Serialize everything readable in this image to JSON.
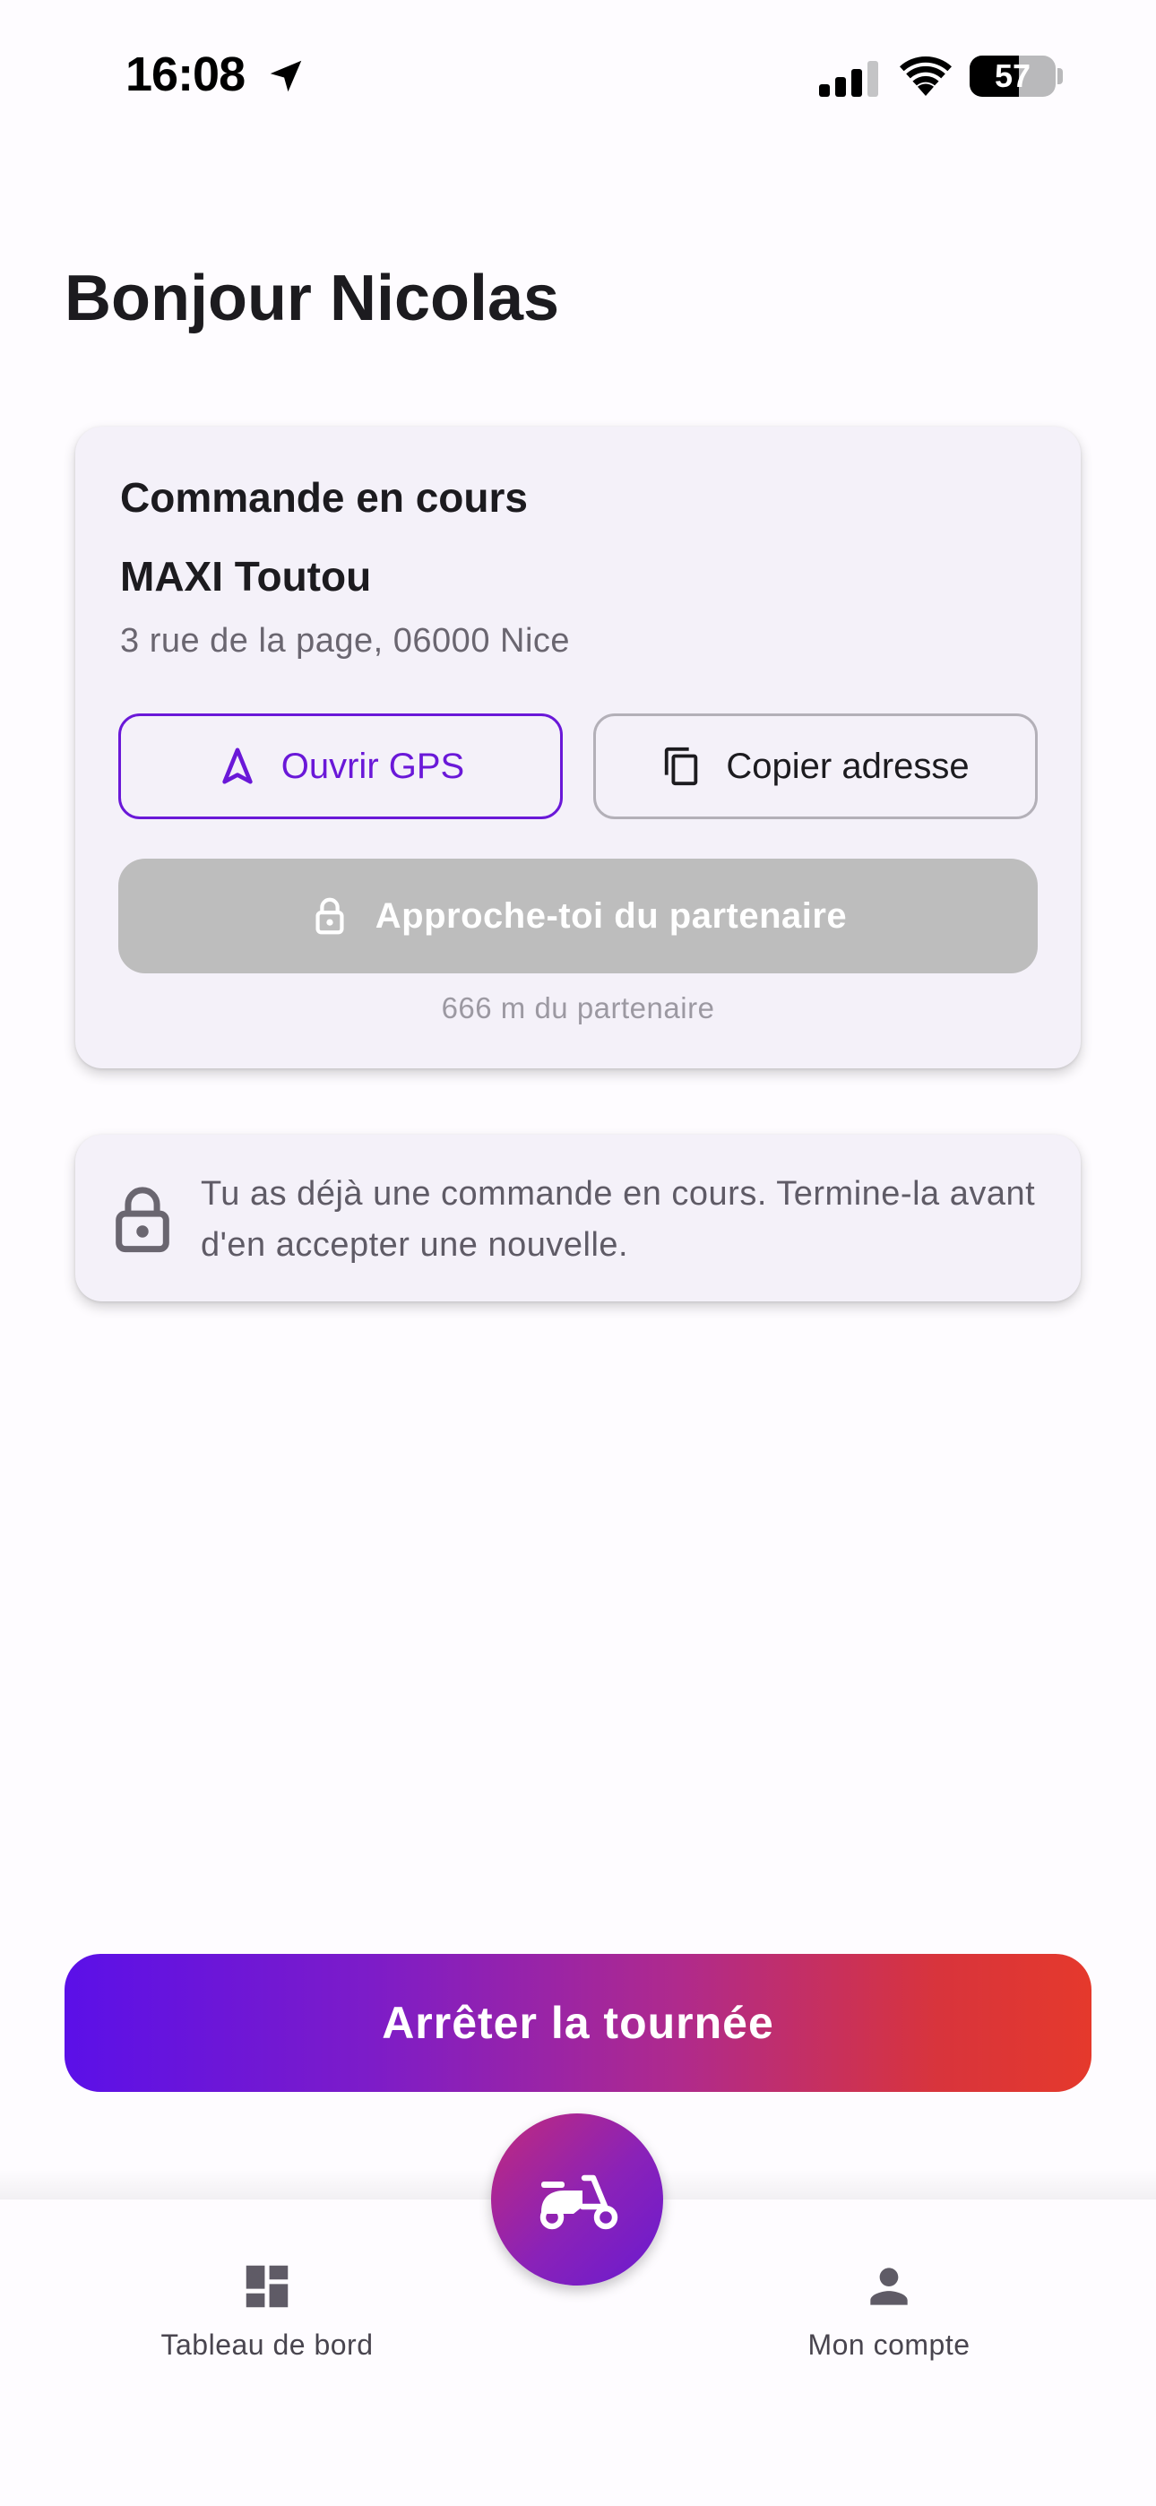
{
  "status_bar": {
    "time": "16:08",
    "battery": "57",
    "battery_level": 0.57,
    "icons": [
      "location-arrow-icon",
      "cellular-signal-icon",
      "wifi-icon",
      "battery-icon"
    ]
  },
  "greeting": "Bonjour Nicolas",
  "order_card": {
    "title": "Commande en cours",
    "partner_name": "MAXI Toutou",
    "address": "3 rue de la page, 06000 Nice",
    "gps_button": {
      "label": "Ouvrir GPS",
      "icon": "navigation-arrow-icon"
    },
    "copy_button": {
      "label": "Copier adresse",
      "icon": "copy-icon"
    },
    "approach_button": {
      "label": "Approche-toi du partenaire",
      "icon": "lock-icon",
      "enabled": false
    },
    "distance": "666 m du partenaire"
  },
  "info_card": {
    "icon": "lock-icon",
    "message": "Tu as déjà une commande en cours. Termine-la avant d'en accepter une nouvelle."
  },
  "stop_button": {
    "label": "Arrêter la tournée"
  },
  "bottom_nav": {
    "items": [
      {
        "label": "Tableau de bord",
        "icon": "dashboard-icon"
      },
      {
        "label": "Mon compte",
        "icon": "person-icon"
      }
    ],
    "fab_icon": "scooter-icon"
  },
  "colors": {
    "accent": "#6a18d8",
    "gradient_start": "#5b10e8",
    "gradient_end": "#e5392c",
    "card_background": "#f4f1f9",
    "disabled": "#bdbdbd"
  }
}
